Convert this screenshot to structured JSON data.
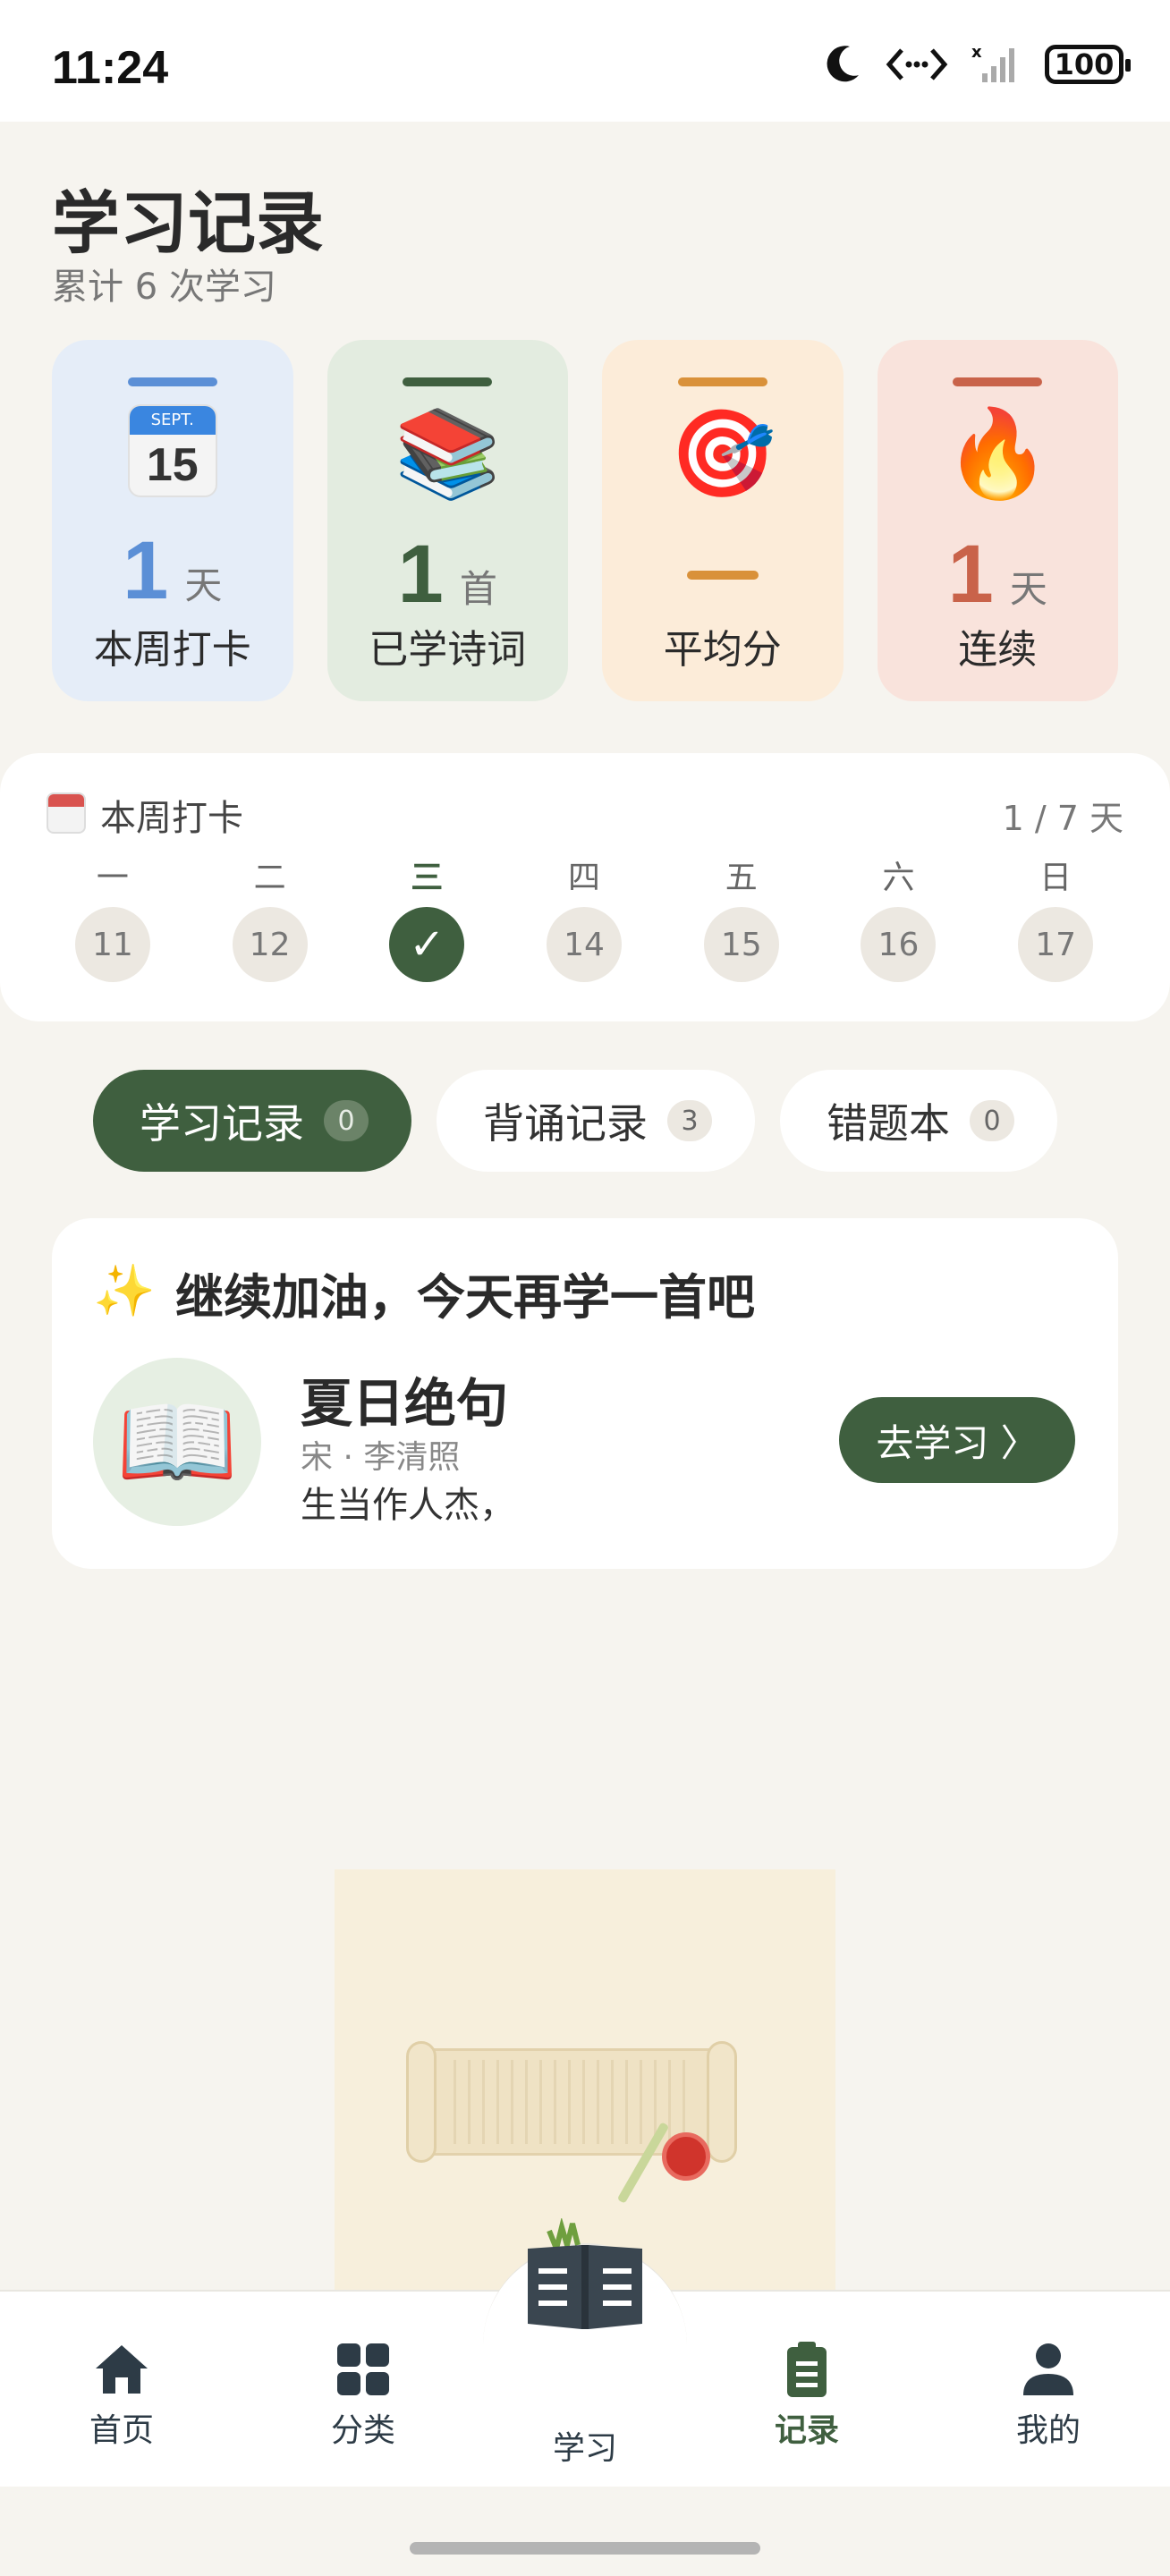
{
  "status_bar": {
    "time": "11:24",
    "battery": "100"
  },
  "header": {
    "title": "学习记录",
    "subtitle": "累计 6 次学习"
  },
  "stats": [
    {
      "name": "weekly-checkin",
      "icon": "calendar-icon",
      "calendar_month": "SEPT.",
      "calendar_day": "15",
      "value": "1",
      "unit": "天",
      "label": "本周打卡",
      "bg": "#e5edf8",
      "accent": "#5b8fd6",
      "value_color": "#5b8fd6"
    },
    {
      "name": "poems-learned",
      "icon": "books-icon",
      "emoji": "📚",
      "value": "1",
      "unit": "首",
      "label": "已学诗词",
      "bg": "#e3ece0",
      "accent": "#3f5f3f",
      "value_color": "#3f5f3f"
    },
    {
      "name": "average-score",
      "icon": "target-icon",
      "emoji": "🎯",
      "value": "",
      "unit": "",
      "label": "平均分",
      "bg": "#fcecd9",
      "accent": "#d9913a",
      "value_color": "#d9913a"
    },
    {
      "name": "streak",
      "icon": "fire-icon",
      "emoji": "🔥",
      "value": "1",
      "unit": "天",
      "label": "连续",
      "bg": "#f9e3dc",
      "accent": "#c9634a",
      "value_color": "#c9634a"
    }
  ],
  "week": {
    "icon": "calendar-small-icon",
    "title": "本周打卡",
    "count": "1 / 7 天",
    "days": [
      {
        "weekday": "一",
        "date": "11",
        "done": false,
        "today": false
      },
      {
        "weekday": "二",
        "date": "12",
        "done": false,
        "today": false
      },
      {
        "weekday": "三",
        "date": "✓",
        "done": true,
        "today": true
      },
      {
        "weekday": "四",
        "date": "14",
        "done": false,
        "today": false
      },
      {
        "weekday": "五",
        "date": "15",
        "done": false,
        "today": false
      },
      {
        "weekday": "六",
        "date": "16",
        "done": false,
        "today": false
      },
      {
        "weekday": "日",
        "date": "17",
        "done": false,
        "today": false
      }
    ]
  },
  "tabs": [
    {
      "label": "学习记录",
      "count": "0",
      "active": true
    },
    {
      "label": "背诵记录",
      "count": "3",
      "active": false
    },
    {
      "label": "错题本",
      "count": "0",
      "active": false
    }
  ],
  "continue": {
    "sparkle": "✨",
    "heading": "继续加油，今天再学一首吧",
    "book_emoji": "📖",
    "poem_title": "夏日绝句",
    "poem_author": "宋 · 李清照",
    "poem_line": "生当作人杰，",
    "button": "去学习 〉"
  },
  "nav": {
    "home": "首页",
    "category": "分类",
    "study": "学习",
    "records": "记录",
    "mine": "我的",
    "active": "records",
    "accent": "#3f5f3f"
  }
}
